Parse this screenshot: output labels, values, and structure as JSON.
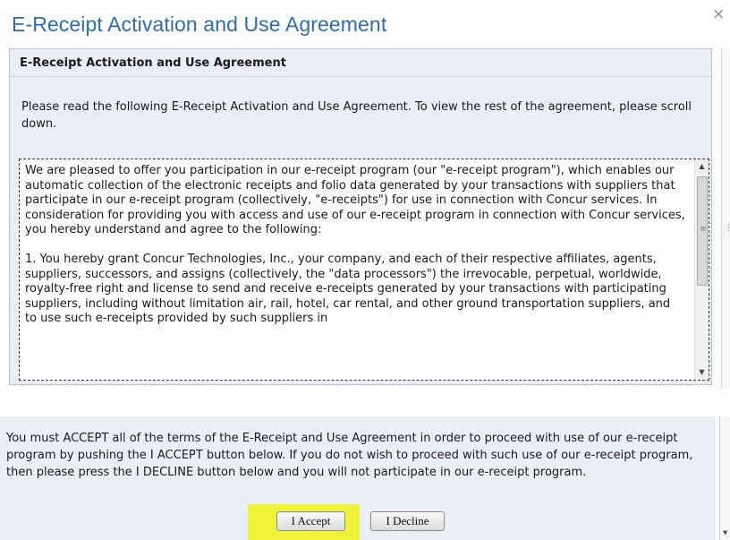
{
  "dialog": {
    "title": "E-Receipt Activation and Use Agreement",
    "close_label": "×"
  },
  "panel": {
    "heading": "E-Receipt Activation and Use Agreement",
    "intro": "Please read the following E-Receipt Activation and Use Agreement. To view the rest of the agreement, please scroll down."
  },
  "agreement": {
    "paragraph_1": "We are pleased to offer you participation in our e-receipt program (our \"e-receipt program\"), which enables our automatic collection of the electronic receipts and folio data generated by your transactions with suppliers that participate in our e-receipt program (collectively, \"e-receipts\") for use in connection with Concur services. In consideration for providing you with access and use of our e-receipt program in connection with Concur services, you hereby understand and agree to the following:",
    "paragraph_2": "1. You hereby grant Concur Technologies, Inc., your company, and each of their respective affiliates, agents, suppliers, successors, and assigns (collectively, the \"data processors\") the irrevocable, perpetual, worldwide, royalty-free right and license to send and receive e-receipts generated by your transactions with participating suppliers, including without limitation air, rail, hotel, car rental, and other ground transportation suppliers, and to use such e-receipts provided by such suppliers in"
  },
  "footer": {
    "text": "You must ACCEPT all of the terms of the E-Receipt and Use Agreement in order to proceed with use of our e-receipt program by pushing the I ACCEPT button below. If you do not wish to proceed with such use of our e-receipt program, then please press the I DECLINE button below and you will not participate in our e-receipt program.",
    "accept_label": "I Accept",
    "decline_label": "I Decline"
  },
  "colors": {
    "title": "#2f6db0",
    "panel_bg": "#eaeef6",
    "highlight": "#f0f23a"
  },
  "icons": {
    "scroll_up": "up-arrow-icon",
    "scroll_down": "down-arrow-icon",
    "grip": "grip-icon",
    "close": "close-icon"
  }
}
